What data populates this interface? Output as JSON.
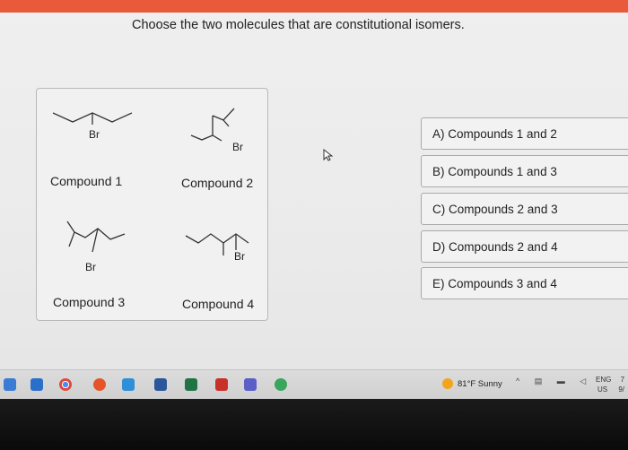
{
  "question": "Choose the two molecules that are constitutional isomers.",
  "compounds": [
    {
      "label": "Compound 1",
      "substituent": "Br"
    },
    {
      "label": "Compound 2",
      "substituent": "Br"
    },
    {
      "label": "Compound 3",
      "substituent": "Br"
    },
    {
      "label": "Compound 4",
      "substituent": "Br"
    }
  ],
  "choices": [
    "A) Compounds 1 and 2",
    "B) Compounds 1 and 3",
    "C) Compounds 2 and 3",
    "D) Compounds 2 and 4",
    "E) Compounds 3 and 4"
  ],
  "taskbar": {
    "weather": "81°F Sunny",
    "lang_line1": "ENG",
    "lang_line2": "US",
    "clock_fragment_1": "7",
    "clock_fragment_2": "9/"
  },
  "colors": {
    "top_bar": "#e85a3a",
    "weather_icon": "#f2a51a"
  },
  "icons": [
    "pointer-cursor-icon",
    "weather-sun-icon",
    "chevron-up-icon",
    "network-icon",
    "battery-icon",
    "speaker-icon"
  ]
}
